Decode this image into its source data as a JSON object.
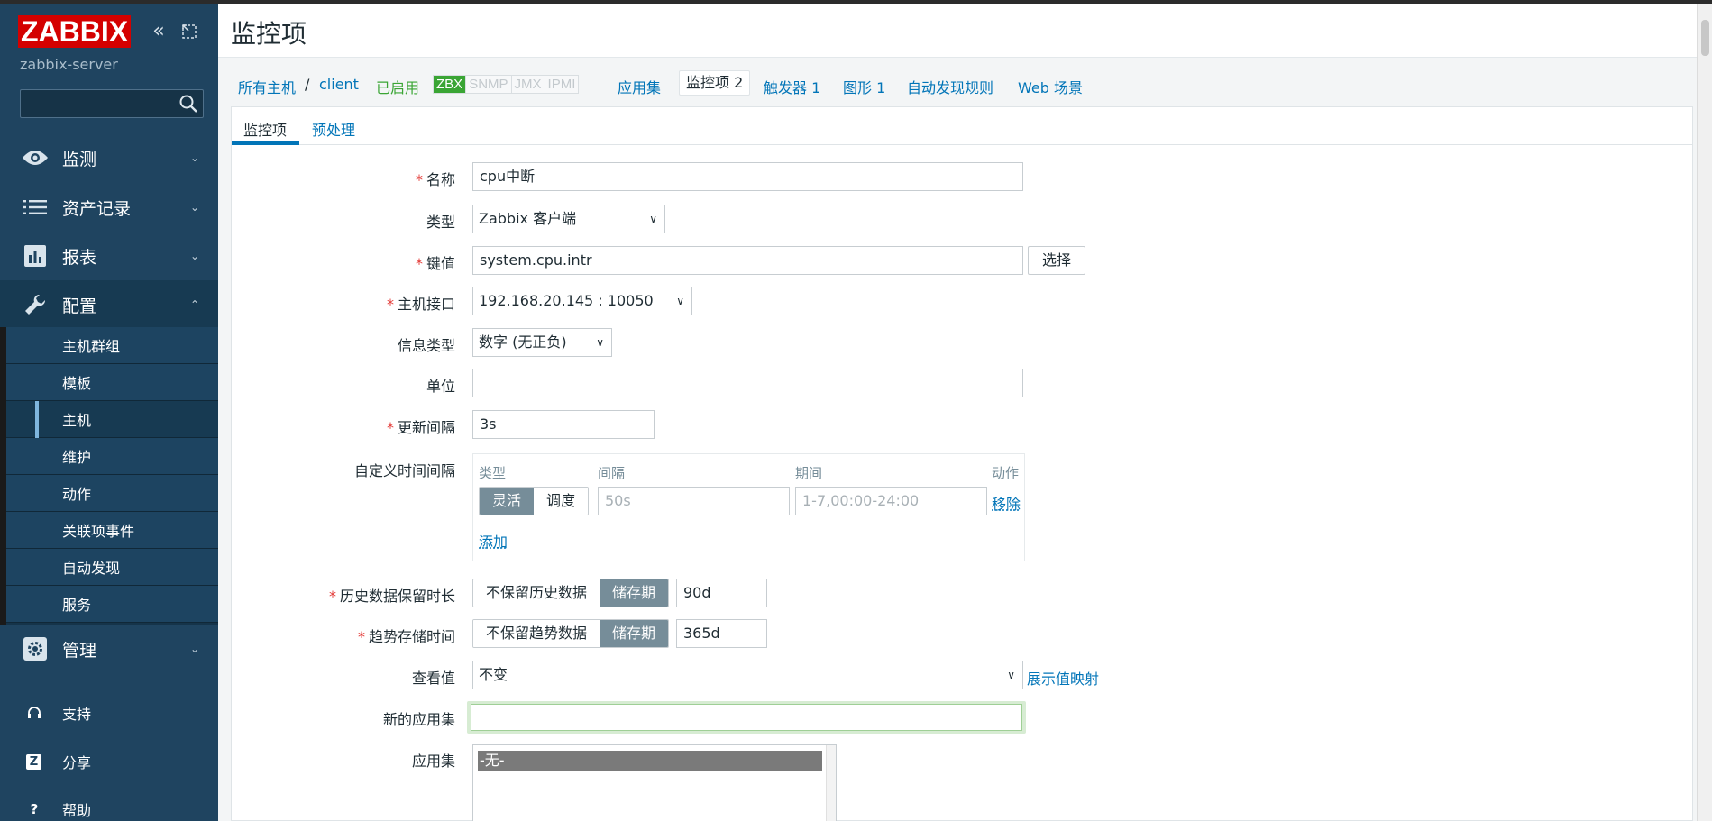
{
  "sidebar": {
    "logo": "ZABBIX",
    "server_name": "zabbix-server",
    "search_placeholder": "",
    "menu": [
      {
        "label": "监测",
        "chevron": "⌄"
      },
      {
        "label": "资产记录",
        "chevron": "⌄"
      },
      {
        "label": "报表",
        "chevron": "⌄"
      },
      {
        "label": "配置",
        "chevron": "⌃"
      },
      {
        "label": "管理",
        "chevron": "⌄"
      }
    ],
    "submenu": [
      "主机群组",
      "模板",
      "主机",
      "维护",
      "动作",
      "关联项事件",
      "自动发现",
      "服务"
    ],
    "bottom": [
      {
        "label": "支持",
        "icon": "headset-icon"
      },
      {
        "label": "分享",
        "icon": "share-icon",
        "glyph": "Z"
      },
      {
        "label": "帮助",
        "icon": "help-icon",
        "glyph": "?"
      }
    ]
  },
  "header": {
    "title": "监控项"
  },
  "breadcrumb": {
    "all_hosts": "所有主机",
    "separator": "/",
    "host": "client",
    "status": "已启用",
    "availability": [
      "ZBX",
      "SNMP",
      "JMX",
      "IPMI"
    ],
    "links": [
      "应用集",
      "监控项 2",
      "触发器 1",
      "图形 1",
      "自动发现规则",
      "Web 场景"
    ]
  },
  "tabs": {
    "items": "监控项",
    "preprocessing": "预处理"
  },
  "form": {
    "name_label": "名称",
    "name_value": "cpu中断",
    "type_label": "类型",
    "type_value": "Zabbix 客户端",
    "key_label": "键值",
    "key_value": "system.cpu.intr",
    "select_button": "选择",
    "interface_label": "主机接口",
    "interface_value": "192.168.20.145 : 10050",
    "info_type_label": "信息类型",
    "info_type_value": "数字 (无正负)",
    "units_label": "单位",
    "units_value": "",
    "interval_label": "更新间隔",
    "interval_value": "3s",
    "custom_label": "自定义时间间隔",
    "custom": {
      "col_type": "类型",
      "col_interval": "间隔",
      "col_period": "期间",
      "col_action": "动作",
      "flexible": "灵活",
      "scheduling": "调度",
      "interval_placeholder": "50s",
      "period_placeholder": "1-7,00:00-24:00",
      "remove": "移除",
      "add": "添加"
    },
    "history_label": "历史数据保留时长",
    "history_nokeep": "不保留历史数据",
    "history_storage": "储存期",
    "history_value": "90d",
    "trends_label": "趋势存储时间",
    "trends_nokeep": "不保留趋势数据",
    "trends_storage": "储存期",
    "trends_value": "365d",
    "valuemap_label": "查看值",
    "valuemap_value": "不变",
    "valuemap_link": "展示值映射",
    "newapp_label": "新的应用集",
    "newapp_value": "",
    "apps_label": "应用集",
    "apps_option": "-无-"
  },
  "colors": {
    "sidebar": "#1f4460",
    "brand": "#d40000",
    "link": "#0275b8",
    "enabled": "#3aa534",
    "required": "#e33734"
  }
}
